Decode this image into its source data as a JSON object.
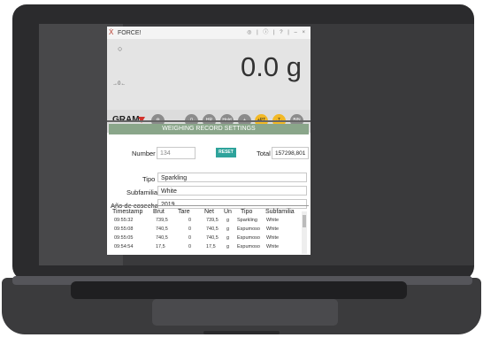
{
  "window": {
    "app_logo": "Ẋ",
    "title": "FORCE!",
    "tb_icons": "◎ | ⓘ | ? | – ×"
  },
  "display": {
    "stable_icon": "○",
    "zero_icon": "→0←",
    "weight": "0.0 g"
  },
  "toolbar": {
    "brand": "GRAM",
    "buttons": [
      {
        "label": "⚙"
      },
      {
        "label": "→0←"
      },
      {
        "label": "HR"
      },
      {
        "label": "Hold"
      },
      {
        "label": "+"
      },
      {
        "label": "+PT"
      },
      {
        "label": "→T←"
      },
      {
        "label": "B/N"
      }
    ]
  },
  "section": {
    "title": "WEIGHING RECORD SETTINGS"
  },
  "form": {
    "number_label": "Number",
    "number_value": "134",
    "reset_label": "RESET",
    "total_label": "Total",
    "total_value": "157298,801",
    "tipo_label": "Tipo",
    "tipo_value": "Sparkling",
    "subfamilia_label": "Subfamilia",
    "subfamilia_value": "White",
    "cosecha_label": "Año de cosecha",
    "cosecha_value": "2019"
  },
  "table": {
    "headers": [
      "Timestamp",
      "Brut",
      "Tare",
      "Net",
      "Un",
      "Tipo",
      "Subfamilia"
    ],
    "rows": [
      [
        "09:55:32",
        "739,5",
        "0",
        "739,5",
        "g",
        "Sparkling",
        "White"
      ],
      [
        "09:55:08",
        "740,5",
        "0",
        "740,5",
        "g",
        "Espumoso",
        "White"
      ],
      [
        "09:55:05",
        "740,5",
        "0",
        "740,5",
        "g",
        "Espumoso",
        "White"
      ],
      [
        "09:54:54",
        "17,5",
        "0",
        "17,5",
        "g",
        "Espumoso",
        "White"
      ]
    ]
  }
}
